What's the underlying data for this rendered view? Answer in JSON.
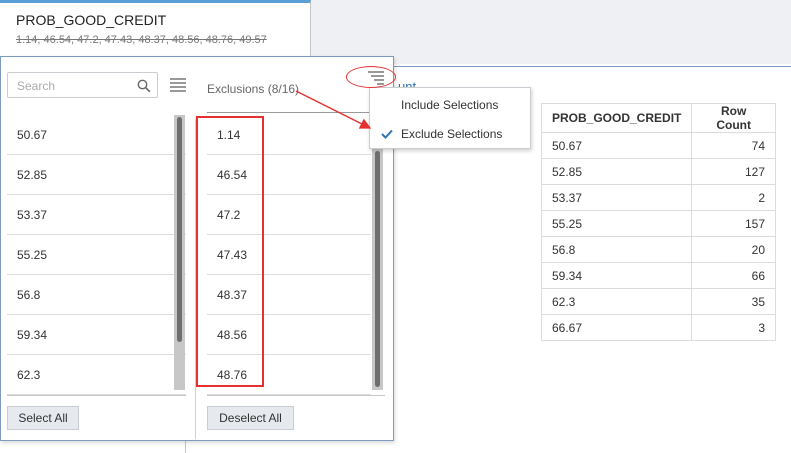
{
  "tab": {
    "title": "PROB_GOOD_CREDIT",
    "values": "1.14, 46.54, 47.2, 47.43, 48.37, 48.56, 48.76, 49.57"
  },
  "filter": {
    "search_placeholder": "Search",
    "available_items": [
      "50.67",
      "52.85",
      "53.37",
      "55.25",
      "56.8",
      "59.34",
      "62.3"
    ],
    "exclusions_title": "Exclusions (8/16)",
    "excluded_items": [
      "1.14",
      "46.54",
      "47.2",
      "47.43",
      "48.37",
      "48.56",
      "48.76"
    ],
    "select_all_label": "Select All",
    "deselect_all_label": "Deselect All"
  },
  "menu": {
    "include_label": "Include Selections",
    "exclude_label": "Exclude Selections",
    "selected": "exclude"
  },
  "background": {
    "partial_link_text": "unt"
  },
  "table": {
    "headers": [
      "PROB_GOOD_CREDIT",
      "Row Count"
    ],
    "rows": [
      [
        "50.67",
        "74"
      ],
      [
        "52.85",
        "127"
      ],
      [
        "53.37",
        "2"
      ],
      [
        "55.25",
        "157"
      ],
      [
        "56.8",
        "20"
      ],
      [
        "59.34",
        "66"
      ],
      [
        "62.3",
        "35"
      ],
      [
        "66.67",
        "3"
      ]
    ]
  },
  "colors": {
    "accent": "#5a9fd6",
    "annotation_red": "#e53030",
    "check_blue": "#2f74b5"
  }
}
